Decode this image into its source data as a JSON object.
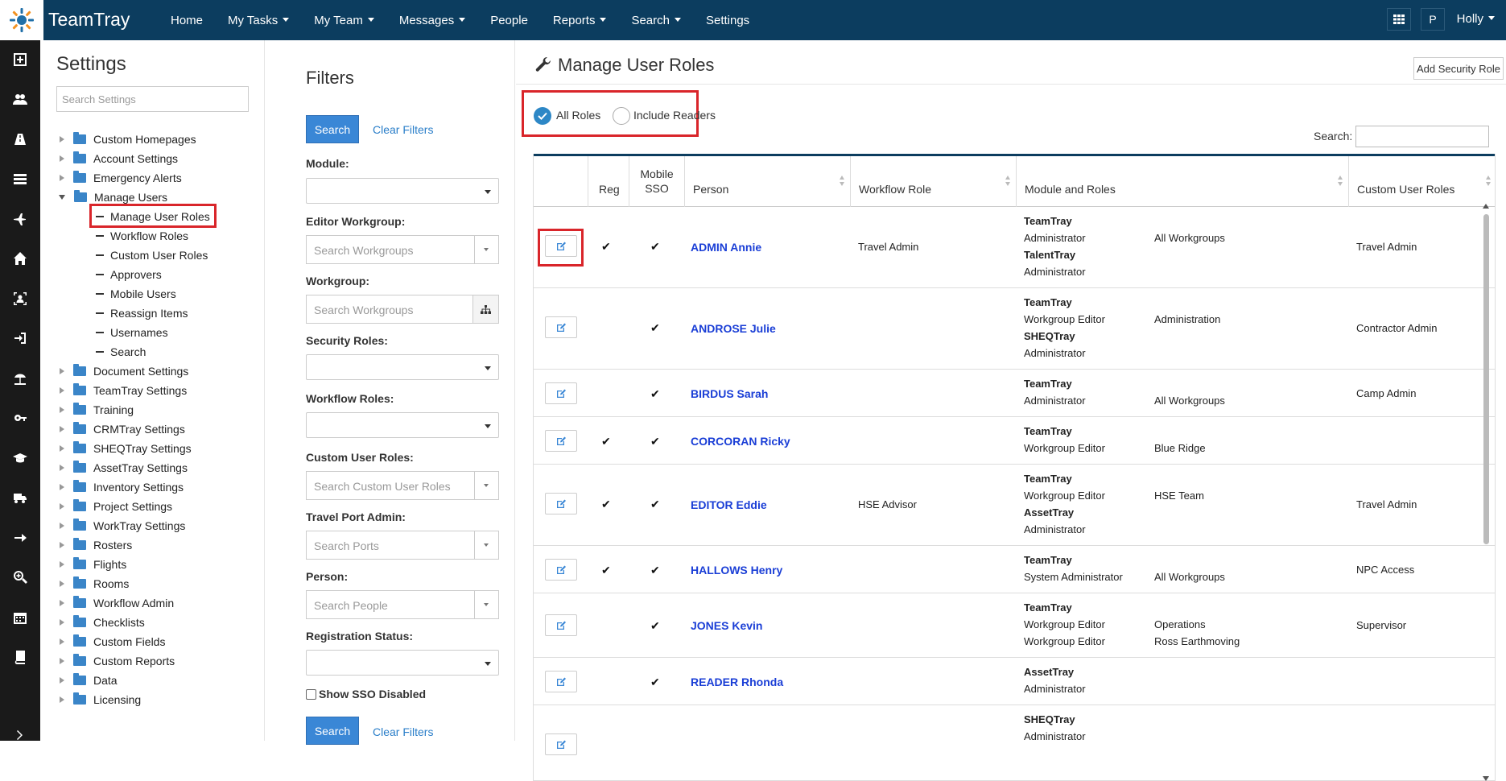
{
  "topbar": {
    "brand": "TeamTray",
    "nav": [
      "Home",
      "My Tasks",
      "My Team",
      "Messages",
      "People",
      "Reports",
      "Search",
      "Settings"
    ],
    "p_badge": "P",
    "user": "Holly"
  },
  "settings": {
    "title": "Settings",
    "search_placeholder": "Search Settings",
    "tree_top": [
      "Custom Homepages",
      "Account Settings",
      "Emergency Alerts",
      "Manage Users"
    ],
    "children": [
      "Manage User Roles",
      "Workflow Roles",
      "Custom User Roles",
      "Approvers",
      "Mobile Users",
      "Reassign Items",
      "Usernames",
      "Search"
    ],
    "tree_bottom": [
      "Document Settings",
      "TeamTray Settings",
      "Training",
      "CRMTray Settings",
      "SHEQTray Settings",
      "AssetTray Settings",
      "Inventory Settings",
      "Project Settings",
      "WorkTray Settings",
      "Rosters",
      "Flights",
      "Rooms",
      "Workflow Admin",
      "Checklists",
      "Custom Fields",
      "Custom Reports",
      "Data",
      "Licensing"
    ]
  },
  "filters": {
    "title": "Filters",
    "search_btn": "Search",
    "clear_link": "Clear Filters",
    "module_label": "Module:",
    "editor_wg_label": "Editor Workgroup:",
    "editor_wg_ph": "Search Workgroups",
    "workgroup_label": "Workgroup:",
    "workgroup_ph": "Search Workgroups",
    "security_label": "Security Roles:",
    "workflow_label": "Workflow Roles:",
    "custom_label": "Custom User Roles:",
    "custom_ph": "Search Custom User Roles",
    "travel_label": "Travel Port Admin:",
    "travel_ph": "Search Ports",
    "person_label": "Person:",
    "person_ph": "Search People",
    "reg_label": "Registration Status:",
    "sso_label": "Show SSO Disabled"
  },
  "main": {
    "title": "Manage User Roles",
    "add_btn": "Add Security Role",
    "radio_all": "All Roles",
    "radio_readers": "Include Readers",
    "search_label": "Search:",
    "headers": {
      "reg": "Reg",
      "mobile": "Mobile",
      "sso": "SSO",
      "person": "Person",
      "workflow": "Workflow Role",
      "module": "Module and Roles",
      "custom": "Custom User Roles"
    },
    "check": "✔",
    "rows": [
      {
        "name": "ADMIN Annie",
        "reg": true,
        "sso": true,
        "workflow": "Travel Admin",
        "modules": [
          [
            "TeamTray",
            "Administrator"
          ],
          [
            "TalentTray",
            "Administrator"
          ]
        ],
        "wg": [
          "All Workgroups"
        ],
        "custom": "Travel Admin"
      },
      {
        "name": "ANDROSE Julie",
        "reg": false,
        "sso": true,
        "workflow": "",
        "modules": [
          [
            "TeamTray",
            "Workgroup Editor"
          ],
          [
            "SHEQTray",
            "Administrator"
          ]
        ],
        "wg": [
          "Administration"
        ],
        "custom": "Contractor Admin"
      },
      {
        "name": "BIRDUS Sarah",
        "reg": false,
        "sso": true,
        "workflow": "",
        "modules": [
          [
            "TeamTray",
            "Administrator"
          ]
        ],
        "wg": [
          "All Workgroups"
        ],
        "custom": "Camp Admin"
      },
      {
        "name": "CORCORAN Ricky",
        "reg": true,
        "sso": true,
        "workflow": "",
        "modules": [
          [
            "TeamTray",
            "Workgroup Editor"
          ]
        ],
        "wg": [
          "Blue Ridge"
        ],
        "custom": ""
      },
      {
        "name": "EDITOR Eddie",
        "reg": true,
        "sso": true,
        "workflow": "HSE Advisor",
        "modules": [
          [
            "TeamTray",
            "Workgroup Editor"
          ],
          [
            "AssetTray",
            "Administrator"
          ]
        ],
        "wg": [
          "HSE Team"
        ],
        "custom": "Travel Admin"
      },
      {
        "name": "HALLOWS Henry",
        "reg": true,
        "sso": true,
        "workflow": "",
        "modules": [
          [
            "TeamTray",
            "System Administrator"
          ]
        ],
        "wg": [
          "All Workgroups"
        ],
        "custom": "NPC Access"
      },
      {
        "name": "JONES Kevin",
        "reg": false,
        "sso": true,
        "workflow": "",
        "modules": [
          [
            "TeamTray",
            "Workgroup Editor",
            "Workgroup Editor"
          ]
        ],
        "wg": [
          "Operations",
          "Ross Earthmoving"
        ],
        "custom": "Supervisor"
      },
      {
        "name": "READER Rhonda",
        "reg": false,
        "sso": true,
        "workflow": "",
        "modules": [
          [
            "AssetTray",
            "Administrator"
          ]
        ],
        "wg": [],
        "custom": ""
      },
      {
        "name": "",
        "reg": false,
        "sso": false,
        "workflow": "",
        "modules": [
          [
            "SHEQTray",
            "Administrator"
          ]
        ],
        "wg": [],
        "custom": ""
      }
    ]
  },
  "colors": {
    "topbar": "#0c3d5f",
    "leftbar": "#1a1a1a",
    "primary": "#3a87d6",
    "link": "#1a3ed6",
    "highlight": "#d9252a"
  }
}
